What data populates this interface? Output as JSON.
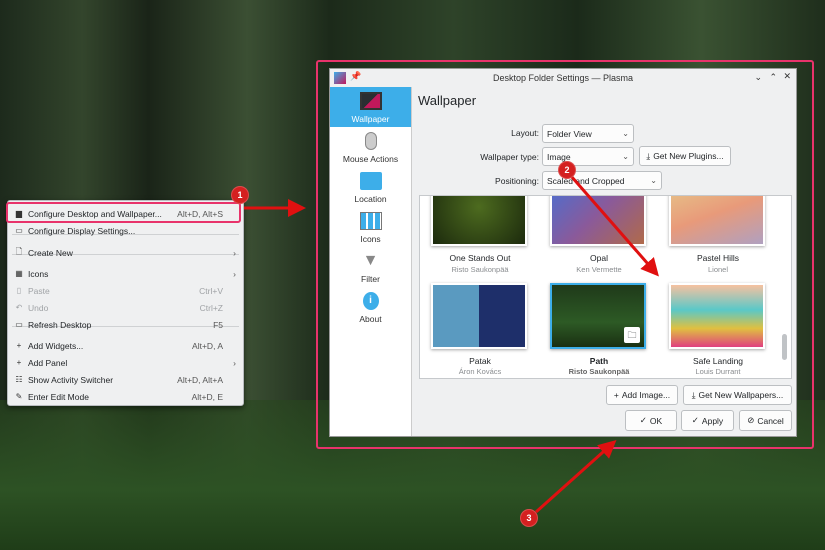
{
  "context_menu": {
    "items": [
      {
        "label": "Configure Desktop and Wallpaper...",
        "shortcut": "Alt+D, Alt+S",
        "icon": "wallpaper-icon"
      },
      {
        "label": "Configure Display Settings...",
        "shortcut": "",
        "icon": "monitor-icon"
      },
      {
        "label": "Create New",
        "shortcut": "",
        "icon": "new-file-icon",
        "submenu": true
      },
      {
        "label": "Icons",
        "shortcut": "",
        "icon": "grid-icon",
        "submenu": true
      },
      {
        "label": "Paste",
        "shortcut": "Ctrl+V",
        "icon": "paste-icon",
        "disabled": true
      },
      {
        "label": "Undo",
        "shortcut": "Ctrl+Z",
        "icon": "undo-icon",
        "disabled": true
      },
      {
        "label": "Refresh Desktop",
        "shortcut": "F5",
        "icon": "refresh-icon"
      },
      {
        "label": "Add Widgets...",
        "shortcut": "Alt+D, A",
        "icon": "plus-icon"
      },
      {
        "label": "Add Panel",
        "shortcut": "",
        "icon": "plus-icon",
        "submenu": true
      },
      {
        "label": "Show Activity Switcher",
        "shortcut": "Alt+D, Alt+A",
        "icon": "activities-icon"
      },
      {
        "label": "Enter Edit Mode",
        "shortcut": "Alt+D, E",
        "icon": "edit-icon"
      }
    ]
  },
  "annotations": {
    "b1": "1",
    "b2": "2",
    "b3": "3",
    "color": "#e8336b",
    "arrow_color": "#e01010"
  },
  "dialog": {
    "title": "Desktop Folder Settings — Plasma",
    "sidebar": [
      "Wallpaper",
      "Mouse Actions",
      "Location",
      "Icons",
      "Filter",
      "About"
    ],
    "heading": "Wallpaper",
    "layout_label": "Layout:",
    "layout_value": "Folder View",
    "type_label": "Wallpaper type:",
    "type_value": "Image",
    "get_plugins": "Get New Plugins...",
    "positioning_label": "Positioning:",
    "positioning_value": "Scaled and Cropped",
    "wallpapers": [
      {
        "name": "One Stands Out",
        "author": "Risto Saukonpää"
      },
      {
        "name": "Opal",
        "author": "Ken Vermette"
      },
      {
        "name": "Pastel Hills",
        "author": "Lionel"
      },
      {
        "name": "Patak",
        "author": "Áron Kovács"
      },
      {
        "name": "Path",
        "author": "Risto Saukonpää",
        "selected": true
      },
      {
        "name": "Safe Landing",
        "author": "Louis Durrant"
      }
    ],
    "add_image": "Add Image...",
    "get_wallpapers": "Get New Wallpapers...",
    "ok": "OK",
    "apply": "Apply",
    "cancel": "Cancel"
  },
  "accent": "#3daee9"
}
